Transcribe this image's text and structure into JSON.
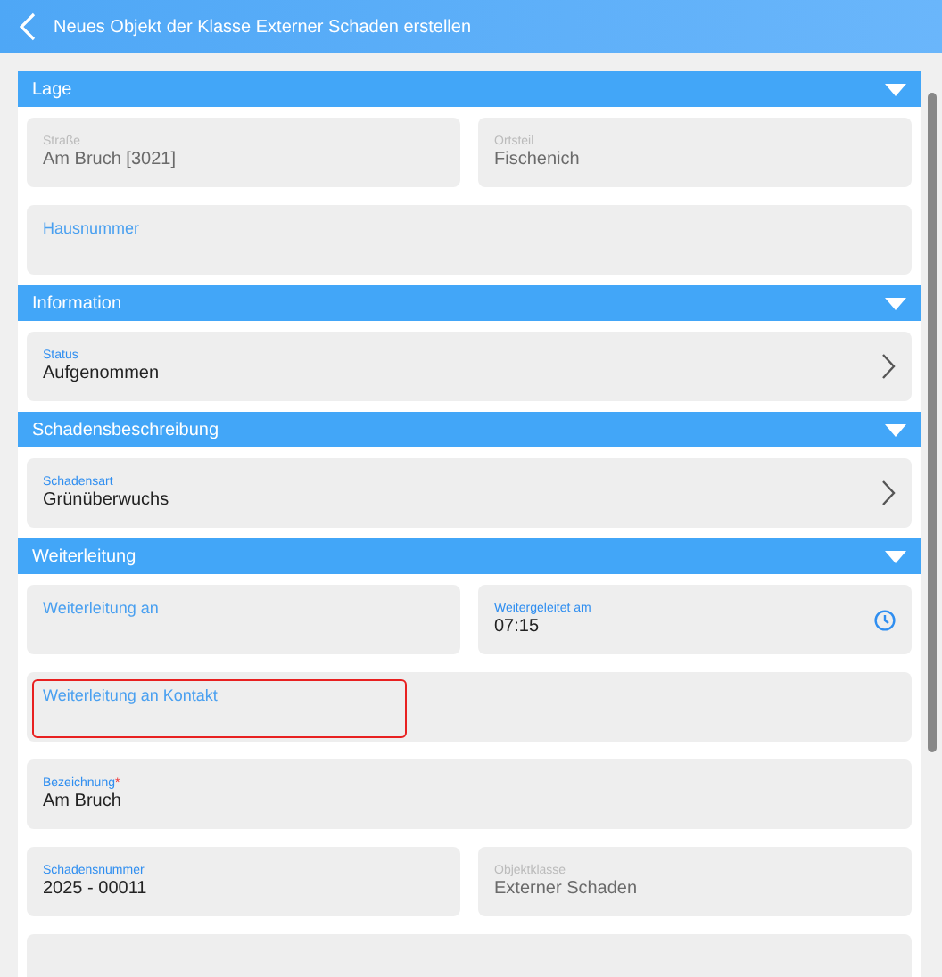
{
  "header": {
    "title": "Neues Objekt der Klasse Externer Schaden erstellen"
  },
  "sections": [
    {
      "title": "Lage",
      "expanded": true,
      "rows": [
        [
          {
            "kind": "text",
            "label": "Straße",
            "value": "Am Bruch [3021]",
            "disabled": true
          },
          {
            "kind": "text",
            "label": "Ortsteil",
            "value": "Fischenich",
            "disabled": true
          }
        ],
        [
          {
            "kind": "text",
            "label": "Hausnummer",
            "disabled": false
          }
        ]
      ]
    },
    {
      "title": "Information",
      "expanded": true,
      "rows": [
        [
          {
            "kind": "select",
            "label": "Status",
            "value": "Aufgenommen",
            "disabled": false
          }
        ]
      ]
    },
    {
      "title": "Schadensbeschreibung",
      "expanded": true,
      "rows": [
        [
          {
            "kind": "select",
            "label": "Schadensart",
            "value": "Grünüberwuchs",
            "disabled": false
          }
        ]
      ]
    },
    {
      "title": "Weiterleitung",
      "expanded": true,
      "rows": [
        [
          {
            "kind": "text",
            "label": "Weiterleitung an",
            "disabled": false
          },
          {
            "kind": "time",
            "label": "Weitergeleitet am",
            "value": "07:15",
            "disabled": false
          }
        ],
        [
          {
            "kind": "text",
            "label": "Weiterleitung an Kontakt",
            "disabled": false,
            "highlighted": true
          }
        ],
        [
          {
            "kind": "text",
            "label": "Bezeichnung",
            "required_mark": "*",
            "value": "Am Bruch",
            "disabled": false
          }
        ],
        [
          {
            "kind": "text",
            "label": "Schadensnummer",
            "value": "2025 - 00011",
            "disabled": false
          },
          {
            "kind": "text",
            "label": "Objektklasse",
            "value": "Externer Schaden",
            "disabled": true
          }
        ],
        [
          {
            "kind": "text",
            "disabled": false
          }
        ]
      ]
    }
  ]
}
